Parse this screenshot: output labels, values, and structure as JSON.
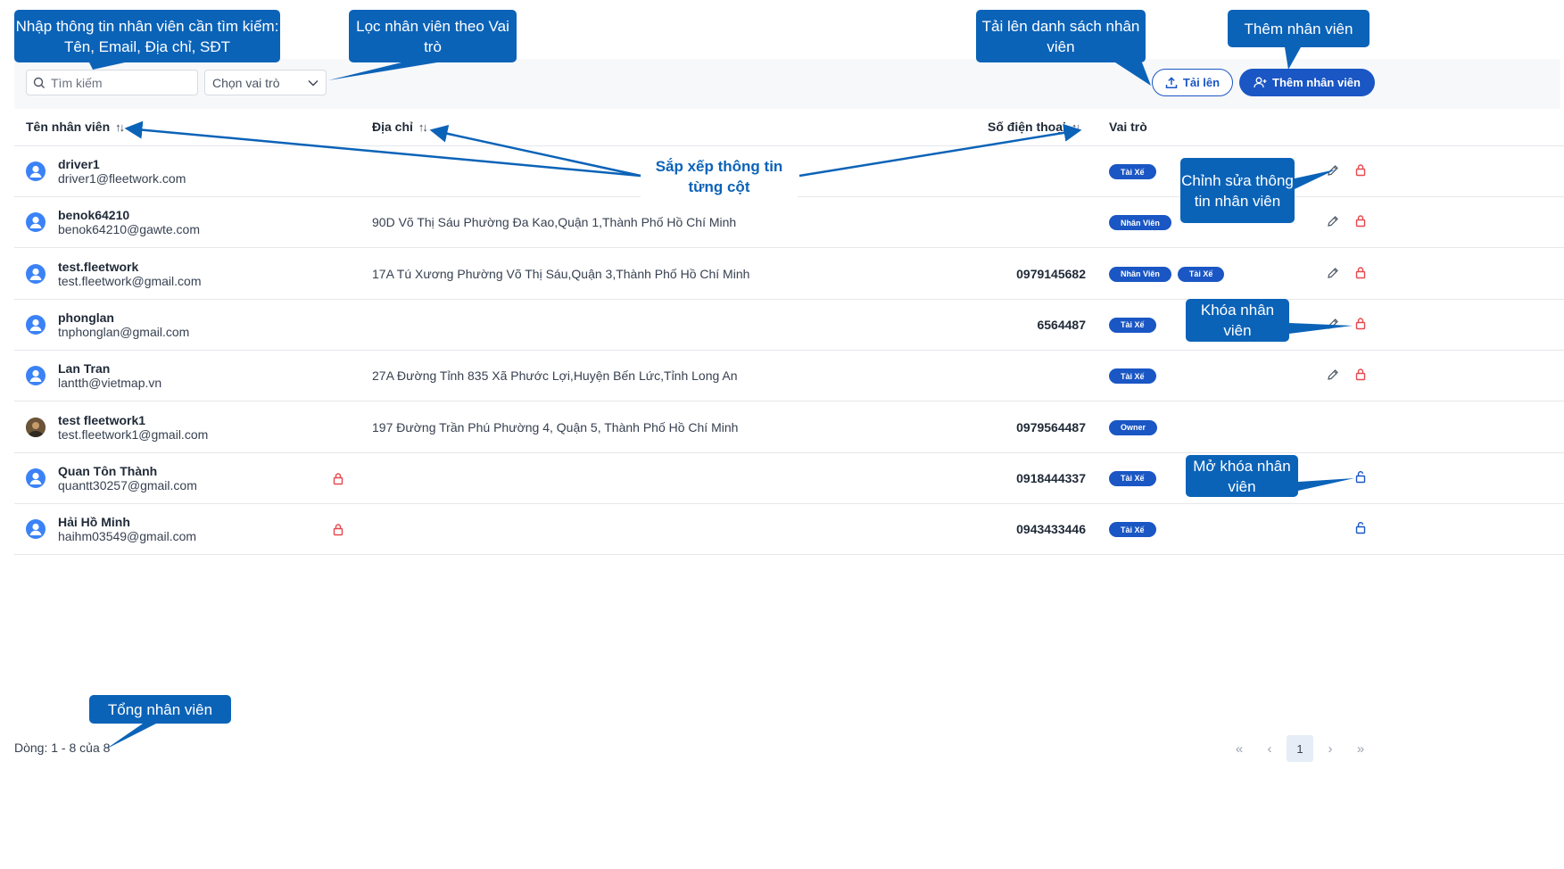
{
  "toolbar": {
    "search_placeholder": "Tìm kiếm",
    "role_filter": "Chọn vai trò",
    "upload_label": "Tải lên",
    "add_label": "Thêm nhân viên"
  },
  "table": {
    "columns": {
      "name": "Tên nhân viên",
      "address": "Địa chỉ",
      "phone": "Số điện thoại",
      "role": "Vai trò"
    },
    "rows": [
      {
        "name": "driver1",
        "email": "driver1@fleetwork.com",
        "address": "",
        "phone": "",
        "roles": [
          "Tài Xế"
        ],
        "locked": false,
        "editable": true,
        "avatar": "default"
      },
      {
        "name": "benok64210",
        "email": "benok64210@gawte.com",
        "address": "90D Võ Thị Sáu Phường Đa Kao,Quận 1,Thành Phố Hồ Chí Minh",
        "phone": "",
        "roles": [
          "Nhân Viên"
        ],
        "locked": false,
        "editable": true,
        "avatar": "default"
      },
      {
        "name": "test.fleetwork",
        "email": "test.fleetwork@gmail.com",
        "address": "17A Tú Xương Phường Võ Thị Sáu,Quận 3,Thành Phố Hồ Chí Minh",
        "phone": "0979145682",
        "roles": [
          "Nhân Viên",
          "Tài Xế"
        ],
        "locked": false,
        "editable": true,
        "avatar": "default"
      },
      {
        "name": "phonglan",
        "email": "tnphonglan@gmail.com",
        "address": "",
        "phone": "6564487",
        "roles": [
          "Tài Xế"
        ],
        "locked": false,
        "editable": true,
        "avatar": "default"
      },
      {
        "name": "Lan Tran",
        "email": "lantth@vietmap.vn",
        "address": "27A Đường Tỉnh 835 Xã Phước Lợi,Huyện Bến Lức,Tỉnh Long An",
        "phone": "",
        "roles": [
          "Tài Xế"
        ],
        "locked": false,
        "editable": true,
        "avatar": "default"
      },
      {
        "name": "test fleetwork1",
        "email": "test.fleetwork1@gmail.com",
        "address": "197 Đường Trần Phú Phường 4, Quận 5, Thành Phố Hồ Chí Minh",
        "phone": "0979564487",
        "roles": [
          "Owner"
        ],
        "locked": false,
        "editable": false,
        "avatar": "photo"
      },
      {
        "name": "Quan Tôn Thành",
        "email": "quantt30257@gmail.com",
        "address": "",
        "phone": "0918444337",
        "roles": [
          "Tài Xế"
        ],
        "locked": true,
        "editable": false,
        "avatar": "default"
      },
      {
        "name": "Hải Hồ Minh",
        "email": "haihm03549@gmail.com",
        "address": "",
        "phone": "0943433446",
        "roles": [
          "Tài Xế"
        ],
        "locked": true,
        "editable": false,
        "avatar": "default"
      }
    ]
  },
  "footer": {
    "count_text": "Dòng: 1 - 8 của 8",
    "current_page": "1"
  },
  "annotations": {
    "search": "Nhập thông tin nhân viên cần tìm kiếm: Tên, Email, Địa chỉ, SĐT",
    "filter": "Lọc nhân viên theo Vai trò",
    "upload": "Tải lên danh sách nhân viên",
    "add": "Thêm nhân viên",
    "sort": "Sắp xếp thông tin từng cột",
    "edit": "Chỉnh sửa thông tin nhân viên",
    "lock": "Khóa nhân viên",
    "unlock": "Mở khóa nhân viên",
    "total": "Tổng nhân viên"
  },
  "colors": {
    "primary": "#1a56c4",
    "callout": "#0b63b8",
    "lock_red": "#e5484d"
  }
}
